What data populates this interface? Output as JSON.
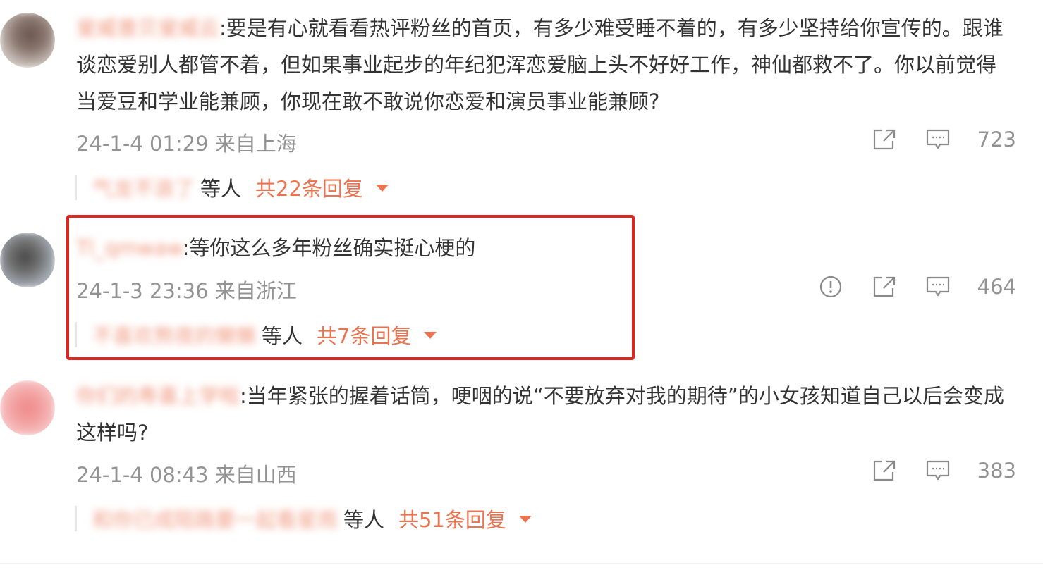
{
  "comments": [
    {
      "username": "叟威普贝叟威云",
      "text": ":要是有心就看看热评粉丝的首页，有多少难受睡不着的，有多少坚持给你宣传的。跟谁谈恋爱别人都管不着，但如果事业起步的年纪犯浑恋爱脑上头不好好工作，神仙都救不了。你以前觉得当爱豆和学业能兼顾，你现在敢不敢说你恋爱和演员事业能兼顾?",
      "time": "24-1-4 01:29",
      "location": "来自上海",
      "likes": "723",
      "reply_names": "气龙不浪了",
      "reply_suffix": "等人",
      "reply_count": "共22条回复",
      "icons": [
        "share-icon",
        "comment-icon",
        "like-icon"
      ]
    },
    {
      "username": "Tl_qmwaw",
      "text": ":等你这么多年粉丝确实挺心梗的",
      "time": "24-1-3 23:36",
      "location": "来自浙江",
      "likes": "464",
      "reply_names": "不喜欢熬夜的懒懒",
      "reply_suffix": "等人",
      "reply_count": "共7条回复",
      "icons": [
        "report-icon",
        "share-icon",
        "comment-icon",
        "like-icon"
      ]
    },
    {
      "username": "你们的寿喜上学啦",
      "text": ":当年紧张的握着话筒，哽咽的说“不要放弃对我的期待”的小女孩知道自己以后会变成这样吗?",
      "time": "24-1-4 08:43",
      "location": "来自山西",
      "likes": "383",
      "reply_names": "和你已成陌路要一起看星雨",
      "reply_suffix": "等人",
      "reply_count": "共51条回复",
      "icons": [
        "share-icon",
        "comment-icon",
        "like-icon"
      ]
    }
  ],
  "colors": {
    "accent": "#eb7350",
    "highlight": "#e0251e",
    "meta": "#939393",
    "text": "#333333"
  }
}
